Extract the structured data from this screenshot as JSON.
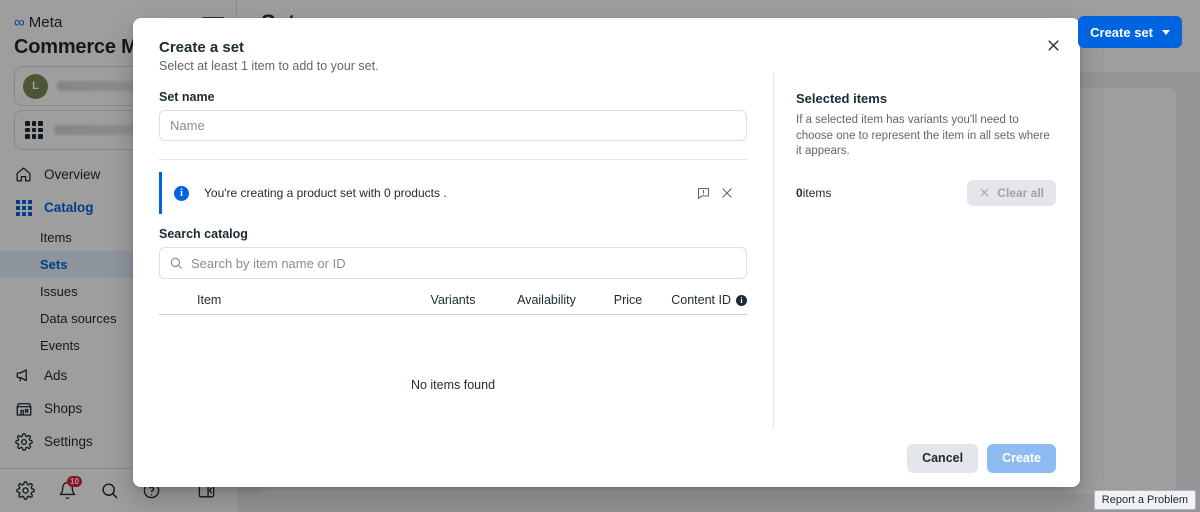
{
  "brand": {
    "logo_text": "Meta",
    "app_title": "Commerce Manager",
    "accent_blue": "#0064e0",
    "active_nav_blue": "#0064e0",
    "banner_blue": "#0064e0"
  },
  "sidebar": {
    "business_selector": {
      "avatar_initial": "L",
      "name_redacted": true
    },
    "catalog_selector": {
      "name_redacted": true
    },
    "nav": [
      {
        "label": "Overview",
        "icon": "home-icon",
        "level": "top",
        "active": false
      },
      {
        "label": "Catalog",
        "icon": "grid-icon",
        "level": "top",
        "active": true
      },
      {
        "label": "Items",
        "level": "sub",
        "active": false
      },
      {
        "label": "Sets",
        "level": "sub",
        "active": true
      },
      {
        "label": "Issues",
        "level": "sub",
        "active": false
      },
      {
        "label": "Data sources",
        "level": "sub",
        "active": false
      },
      {
        "label": "Events",
        "level": "sub",
        "active": false
      },
      {
        "label": "Ads",
        "icon": "megaphone-icon",
        "level": "top",
        "active": false
      },
      {
        "label": "Shops",
        "icon": "shop-icon",
        "level": "top",
        "active": false
      },
      {
        "label": "Settings",
        "icon": "gear-icon",
        "level": "top",
        "active": false
      }
    ],
    "footer_icons": [
      {
        "name": "gear-icon"
      },
      {
        "name": "bell-icon",
        "badge": "10"
      },
      {
        "name": "search-icon"
      },
      {
        "name": "help-icon"
      },
      {
        "name": "panel-toggle-icon"
      }
    ]
  },
  "main": {
    "page_title": "Sets",
    "create_set_label": "Create set",
    "report_problem_label": "Report a Problem"
  },
  "modal": {
    "title": "Create a set",
    "subtitle": "Select at least 1 item to add to your set.",
    "close_icon": "close-icon",
    "set_name": {
      "label": "Set name",
      "placeholder": "Name",
      "value": ""
    },
    "info_banner": {
      "icon": "info-icon",
      "text": "You're creating a product set with 0 products .",
      "feedback_icon": "feedback-icon",
      "dismiss_icon": "close-icon"
    },
    "search": {
      "label": "Search catalog",
      "placeholder": "Search by item name or ID",
      "value": "",
      "icon": "search-icon"
    },
    "table": {
      "columns": [
        "Item",
        "Variants",
        "Availability",
        "Price",
        "Content ID"
      ],
      "content_id_info_icon": "info-icon",
      "rows": [],
      "empty_message": "No items found"
    },
    "selected_panel": {
      "title": "Selected items",
      "description": "If a selected item has variants you'll need to choose one to represent the item in all sets where it appears.",
      "count": "0",
      "count_unit": "items",
      "clear_all_label": "Clear all",
      "clear_all_icon": "close-icon",
      "clear_all_disabled": true
    },
    "footer": {
      "cancel_label": "Cancel",
      "create_label": "Create",
      "create_disabled": true
    }
  }
}
